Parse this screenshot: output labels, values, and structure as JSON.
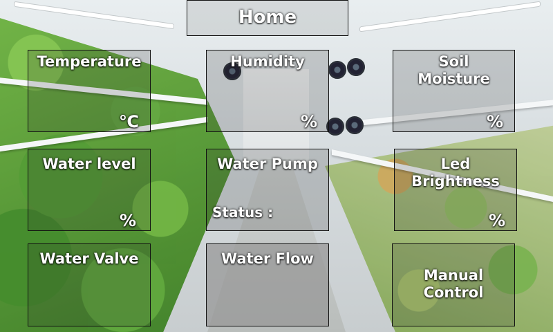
{
  "header": {
    "home_label": "Home"
  },
  "tiles": {
    "temperature": {
      "title": "Temperature",
      "unit": "℃"
    },
    "humidity": {
      "title": "Humidity",
      "unit": "%"
    },
    "soil_moisture": {
      "title_line1": "Soil",
      "title_line2": "Moisture",
      "unit": "%"
    },
    "water_level": {
      "title": "Water level",
      "unit": "%"
    },
    "water_pump": {
      "title": "Water Pump",
      "status_label": "Status :"
    },
    "led_brightness": {
      "title_line1": "Led",
      "title_line2": "Brightness",
      "unit": "%"
    },
    "water_valve": {
      "title": "Water Valve"
    },
    "water_flow": {
      "title": "Water Flow"
    },
    "manual_control": {
      "title_line1": "Manual",
      "title_line2": "Control"
    }
  },
  "colors": {
    "panel_gray": "#969696",
    "text": "#ffffff",
    "border": "#111111"
  }
}
